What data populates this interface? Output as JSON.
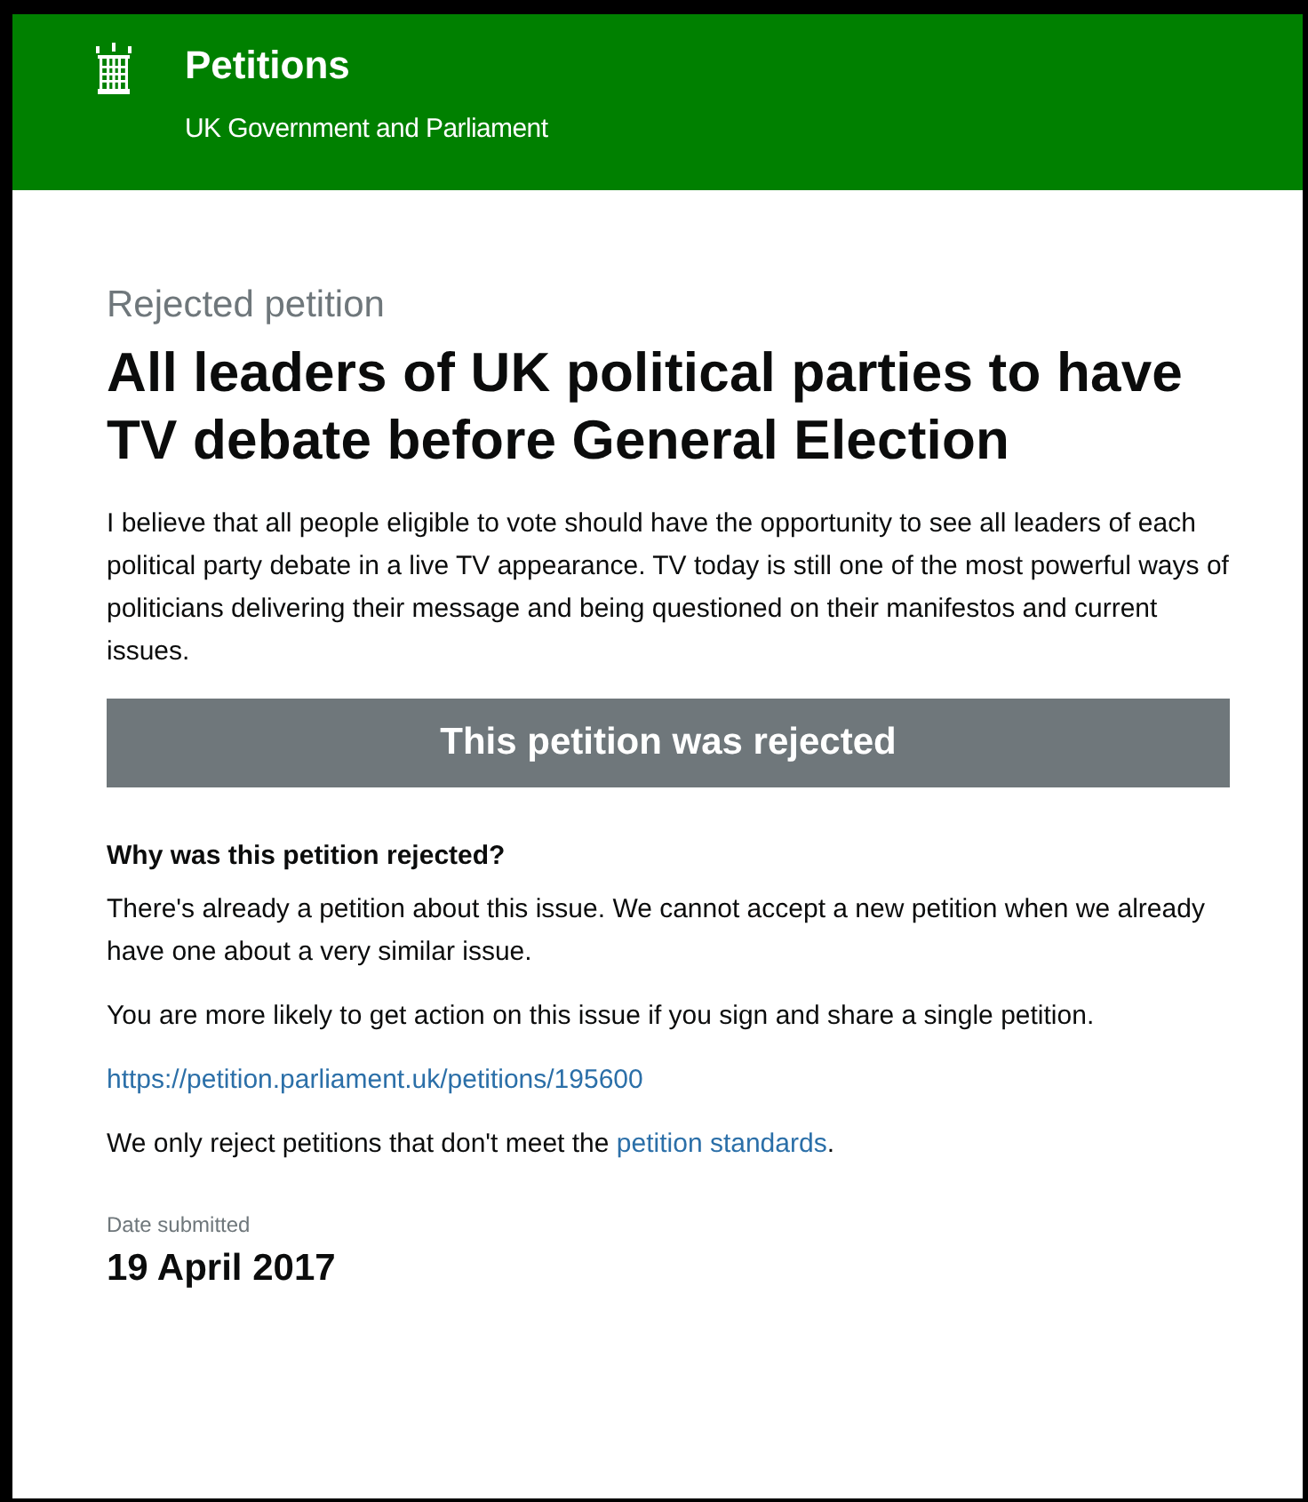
{
  "header": {
    "title": "Petitions",
    "subtitle": "UK Government and Parliament"
  },
  "petition": {
    "status_label": "Rejected petition",
    "title": "All leaders of UK political parties to have TV debate before General Election",
    "description": "I believe that all people eligible to vote should have the opportunity to see all leaders of each political party debate in a live TV appearance. TV today is still one of the most powerful ways of politicians delivering their message and being questioned on their manifestos and current issues.",
    "banner": "This petition was rejected"
  },
  "rejection": {
    "heading": "Why was this petition rejected?",
    "paragraphs": [
      "There's already a petition about this issue. We cannot accept a new petition when we already have one about a very similar issue.",
      "You are more likely to get action on this issue if you sign and share a single petition."
    ],
    "url": "https://petition.parliament.uk/petitions/195600",
    "standards_note": {
      "before": "We only reject petitions that don't meet the ",
      "link": "petition standards",
      "after": "."
    }
  },
  "date": {
    "label": "Date submitted",
    "value": "19 April 2017"
  }
}
